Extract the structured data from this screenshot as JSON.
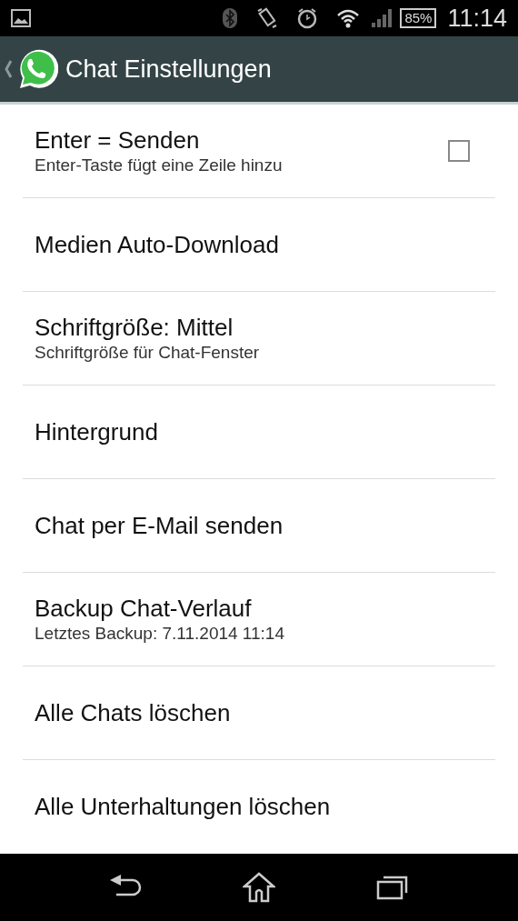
{
  "status_bar": {
    "battery": "85%",
    "time": "11:14"
  },
  "action_bar": {
    "title": "Chat Einstellungen"
  },
  "settings": [
    {
      "kind": "checkbox",
      "title": "Enter = Senden",
      "summary": "Enter-Taste fügt eine Zeile hinzu",
      "checked": false
    },
    {
      "kind": "plain",
      "title": "Medien Auto-Download"
    },
    {
      "kind": "plain",
      "title": "Schriftgröße: Mittel",
      "summary": "Schriftgröße für Chat-Fenster"
    },
    {
      "kind": "plain",
      "title": "Hintergrund"
    },
    {
      "kind": "plain",
      "title": "Chat per E-Mail senden"
    },
    {
      "kind": "plain",
      "title": "Backup Chat-Verlauf",
      "summary": "Letztes Backup: 7.11.2014 11:14"
    },
    {
      "kind": "plain",
      "title": "Alle Chats löschen"
    },
    {
      "kind": "plain",
      "title": "Alle Unterhaltungen löschen"
    }
  ]
}
